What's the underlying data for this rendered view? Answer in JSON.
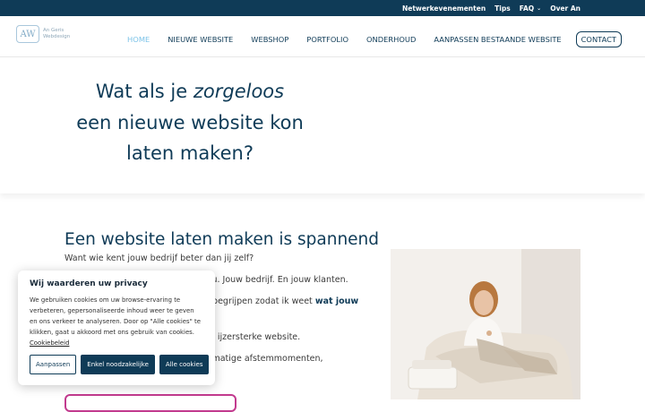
{
  "topbar": {
    "links": [
      "Netwerkevenementen",
      "Tips",
      "FAQ",
      "Over An"
    ]
  },
  "logo": {
    "mark": "AW",
    "line1": "An Geris",
    "line2": "Webdesign"
  },
  "nav": {
    "items": [
      "HOME",
      "NIEUWE WEBSITE",
      "WEBSHOP",
      "PORTFOLIO",
      "ONDERHOUD",
      "AANPASSEN BESTAANDE WEBSITE"
    ],
    "contact": "CONTACT"
  },
  "hero": {
    "pre": "Wat als je ",
    "em": "zorgeloos",
    "line2": "een nieuwe website kon",
    "line3": "laten maken?"
  },
  "section": {
    "title": "Een website laten maken is spannend",
    "subtitle": "Want wie kent jouw bedrijf beter dan jij zelf?",
    "p1": "jou. Jouw bedrijf. En jouw klanten.",
    "p2_pre": "n begrijpen zodat ik weet ",
    "p2_bold": "wat jouw",
    "p4": "en ijzersterke website.",
    "p5": "elmatige afstemmomenten,"
  },
  "cookie": {
    "title": "Wij waarderen uw privacy",
    "text": "We gebruiken cookies om uw browse-ervaring te verbeteren, gepersonaliseerde inhoud weer te geven en ons verkeer te analyseren. Door op \"Alle cookies\" te klikken, gaat u akkoord met ons gebruik van cookies.",
    "link": "Cookiebeleid",
    "btn_customize": "Aanpassen",
    "btn_necessary": "Enkel noodzakelijke",
    "btn_all": "Alle cookies"
  },
  "colors": {
    "primary": "#0f3b57",
    "active": "#7cc3e8",
    "accent": "#c23a8e"
  }
}
